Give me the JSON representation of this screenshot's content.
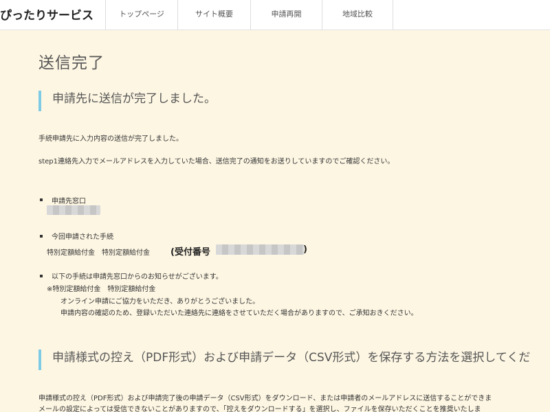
{
  "header": {
    "logo": "ぴったりサービス",
    "nav": [
      {
        "label": "トップページ"
      },
      {
        "label": "サイト概要"
      },
      {
        "label": "申請再開"
      },
      {
        "label": "地域比較"
      }
    ]
  },
  "main": {
    "page_title": "送信完了",
    "section1_heading": "申請先に送信が完了しました。",
    "intro_line1": "手続申請先に入力内容の送信が完了しました。",
    "intro_line2": "step1連絡先入力でメールアドレスを入力していた場合、送信完了の通知をお送りしていますのでご確認ください。",
    "destination_label": "申請先窓口",
    "procedure_label": "今回申請された手続",
    "procedure_names": "特別定額給付金　特別定額給付金",
    "receipt_open": "(受付番号",
    "receipt_close": ")",
    "notice_label": "以下の手続は申請先窓口からのお知らせがございます。",
    "notice_title": "※特別定額給付金　特別定額給付金",
    "notice_line1": "オンライン申請にご協力をいただき、ありがとうございました。",
    "notice_line2": "申請内容の確認のため、登録いただいた連絡先に連絡をさせていただく場合がありますので、ご承知おきください。",
    "section2_heading": "申請様式の控え（PDF形式）および申請データ（CSV形式）を保存する方法を選択してくだ",
    "bottom_line1": "申請様式の控え（PDF形式）および申請完了後の申請データ（CSV形式）をダウンロード、または申請者のメールアドレスに送信することができま",
    "bottom_line2": "メールの設定によっては受信できないことがありますので、「控えをダウンロードする」を選択し、ファイルを保存いただくことを推奨いたしま"
  }
}
